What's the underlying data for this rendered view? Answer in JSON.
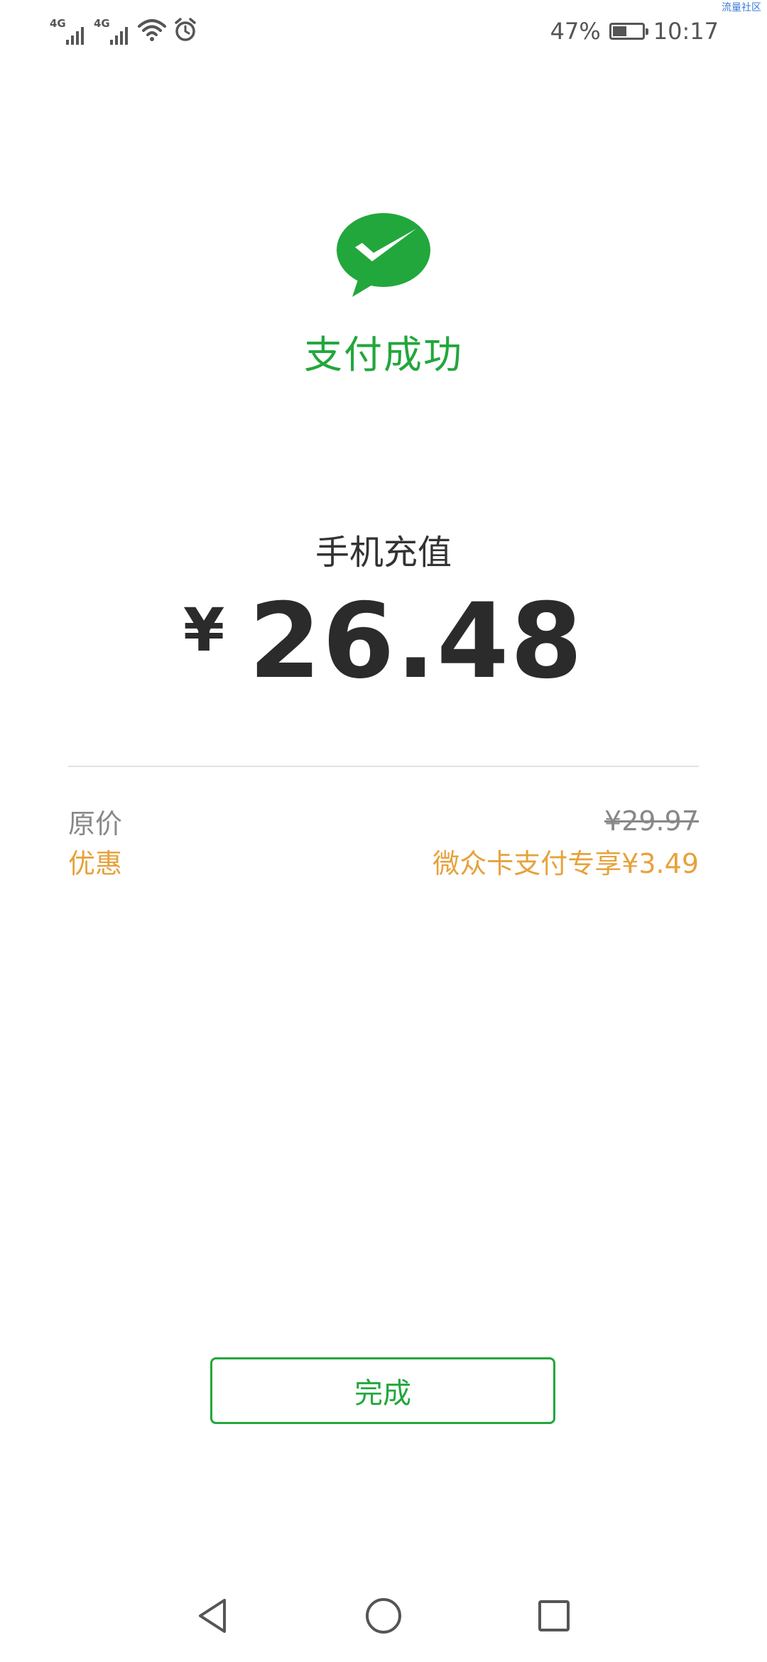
{
  "watermark": "流量社区",
  "status_bar": {
    "network_1": "4G",
    "network_2": "4G",
    "battery_percent": "47%",
    "battery_level": 0.47,
    "time": "10:17"
  },
  "success": {
    "title": "支付成功"
  },
  "payment": {
    "product": "手机充值",
    "currency_symbol": "¥",
    "amount": "26.48"
  },
  "details": [
    {
      "label": "原价",
      "value": "¥29.97"
    },
    {
      "label": "优惠",
      "value": "微众卡支付专享¥3.49"
    }
  ],
  "actions": {
    "done_label": "完成"
  },
  "icons": {
    "logo": "wechat-pay-success-icon",
    "signal": "signal-icon",
    "wifi": "wifi-icon",
    "alarm": "alarm-icon",
    "battery": "battery-icon",
    "back": "back-triangle-icon",
    "home": "home-circle-icon",
    "recent": "recent-square-icon"
  },
  "colors": {
    "brand_green": "#22a73c",
    "discount_orange": "#e6a23c",
    "text_dark": "#2b2b2b",
    "text_gray": "#888888"
  }
}
